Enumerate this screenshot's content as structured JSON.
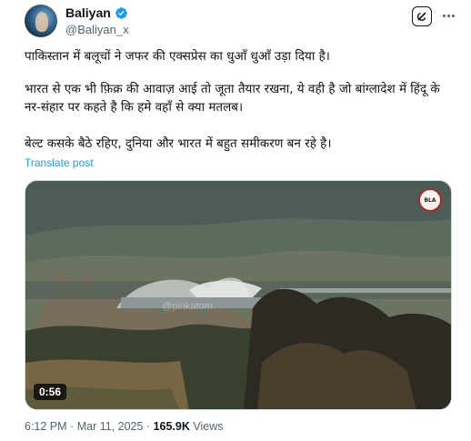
{
  "author": {
    "name": "Baliyan",
    "handle": "@Baliyan_x",
    "verified": true,
    "avatar_icon": "profile-avatar"
  },
  "actions": {
    "grok_icon": "grok-icon",
    "more_icon": "more-horizontal-icon"
  },
  "tweet": {
    "paragraphs": [
      "पाकिस्तान में बलूचों ने जफर की एक्सप्रेस का धुआँ धुआँ उड़ा दिया है।",
      "भारत से एक भी फ़िक्र की आवाज़ आई तो जूता तैयार रखना, ये वही है जो बांग्लादेश में हिंदू के नर-संहार पर कहते है कि हमे वहाँ से क्या मतलब।",
      "बेल्ट कसके बैठे रहिए, दुनिया और भारत में बहुत समीकरण बन रहे है।"
    ],
    "translate_label": "Translate post"
  },
  "media": {
    "type": "video",
    "duration": "0:56",
    "watermark": "@pinkatom",
    "logo_text": "BLA"
  },
  "meta": {
    "time": "6:12 PM",
    "separator": "·",
    "date": "Mar 11, 2025",
    "views_count": "165.9K",
    "views_label": "Views"
  },
  "colors": {
    "link": "#1d9bf0",
    "verified": "#1d9bf0",
    "secondary_text": "#536471"
  }
}
